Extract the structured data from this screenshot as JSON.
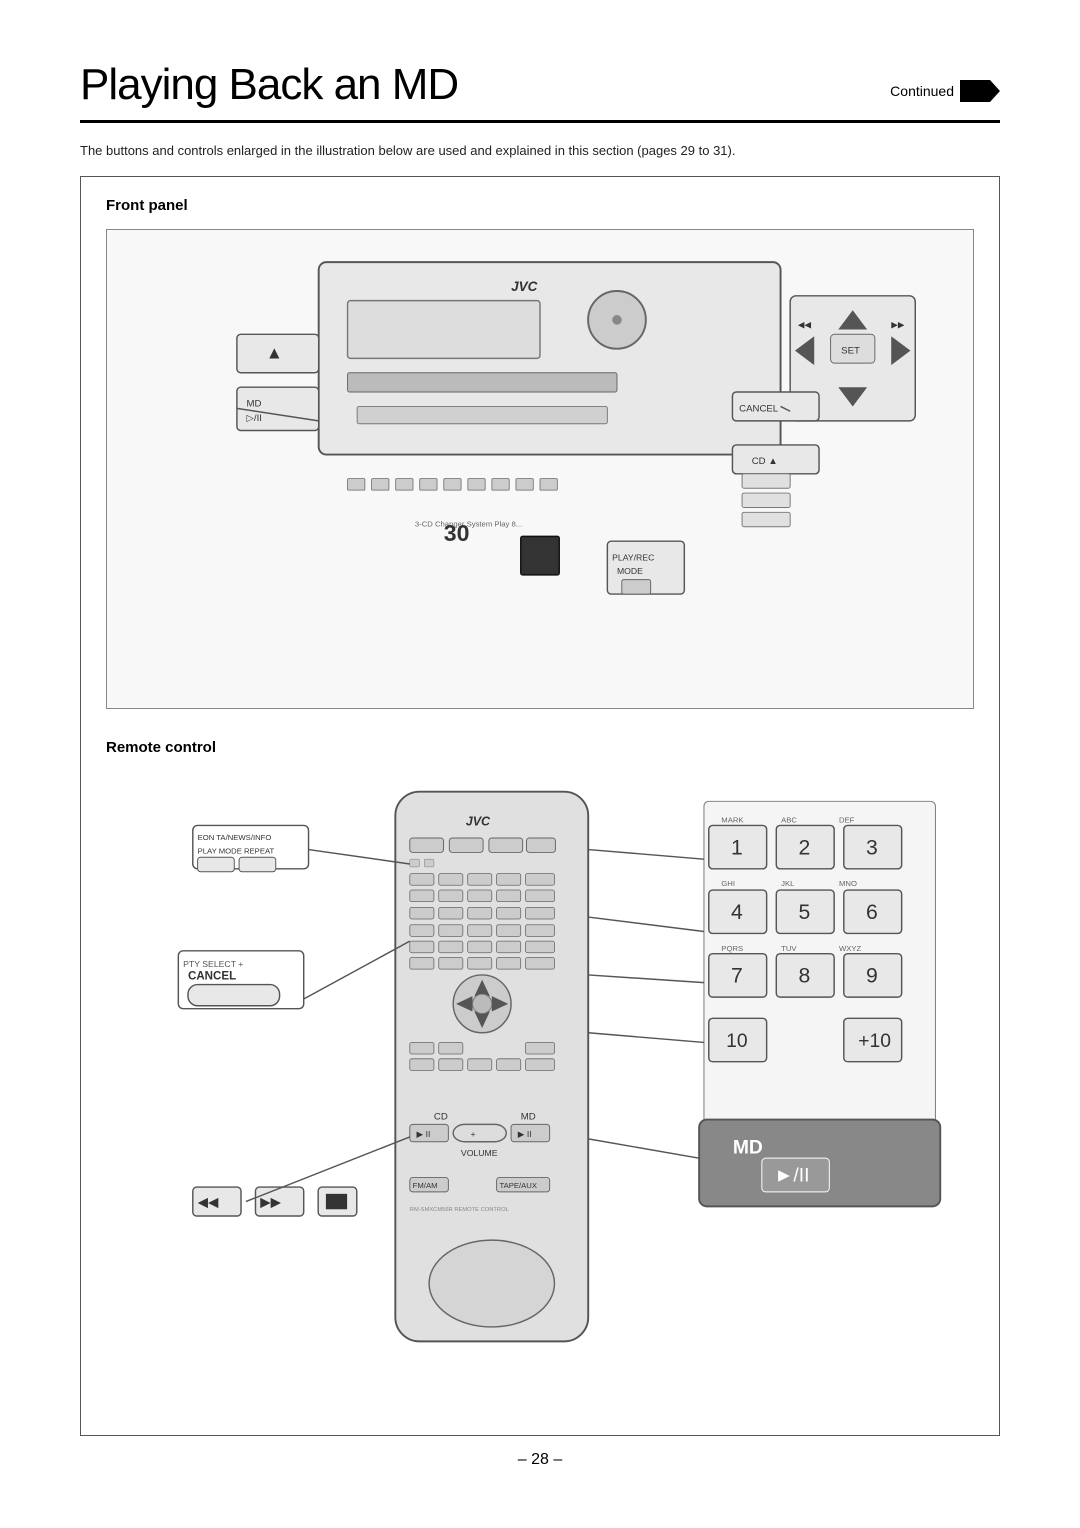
{
  "page": {
    "title": "Playing Back an MD",
    "continued_label": "Continued",
    "description": "The buttons and controls enlarged in the illustration below are used and explained in this section (pages 29 to 31).",
    "page_number": "– 28 –",
    "front_panel_label": "Front panel",
    "remote_control_label": "Remote control",
    "cancel_label": "CANCEL",
    "play_rec_mode_label": "PLAY/REC\nMODE",
    "md_play_label": "MD ▷/II",
    "md_label": "MD",
    "play_pause_label": "►/II",
    "pty_select_cancel_label": "PTY SELECT +\nCANCEL",
    "eon_label": "EON",
    "ta_news_label": "TA/NEWS/INFO",
    "play_mode_label": "PLAY MODE",
    "repeat_label": "REPEAT",
    "set_label": "SET"
  }
}
